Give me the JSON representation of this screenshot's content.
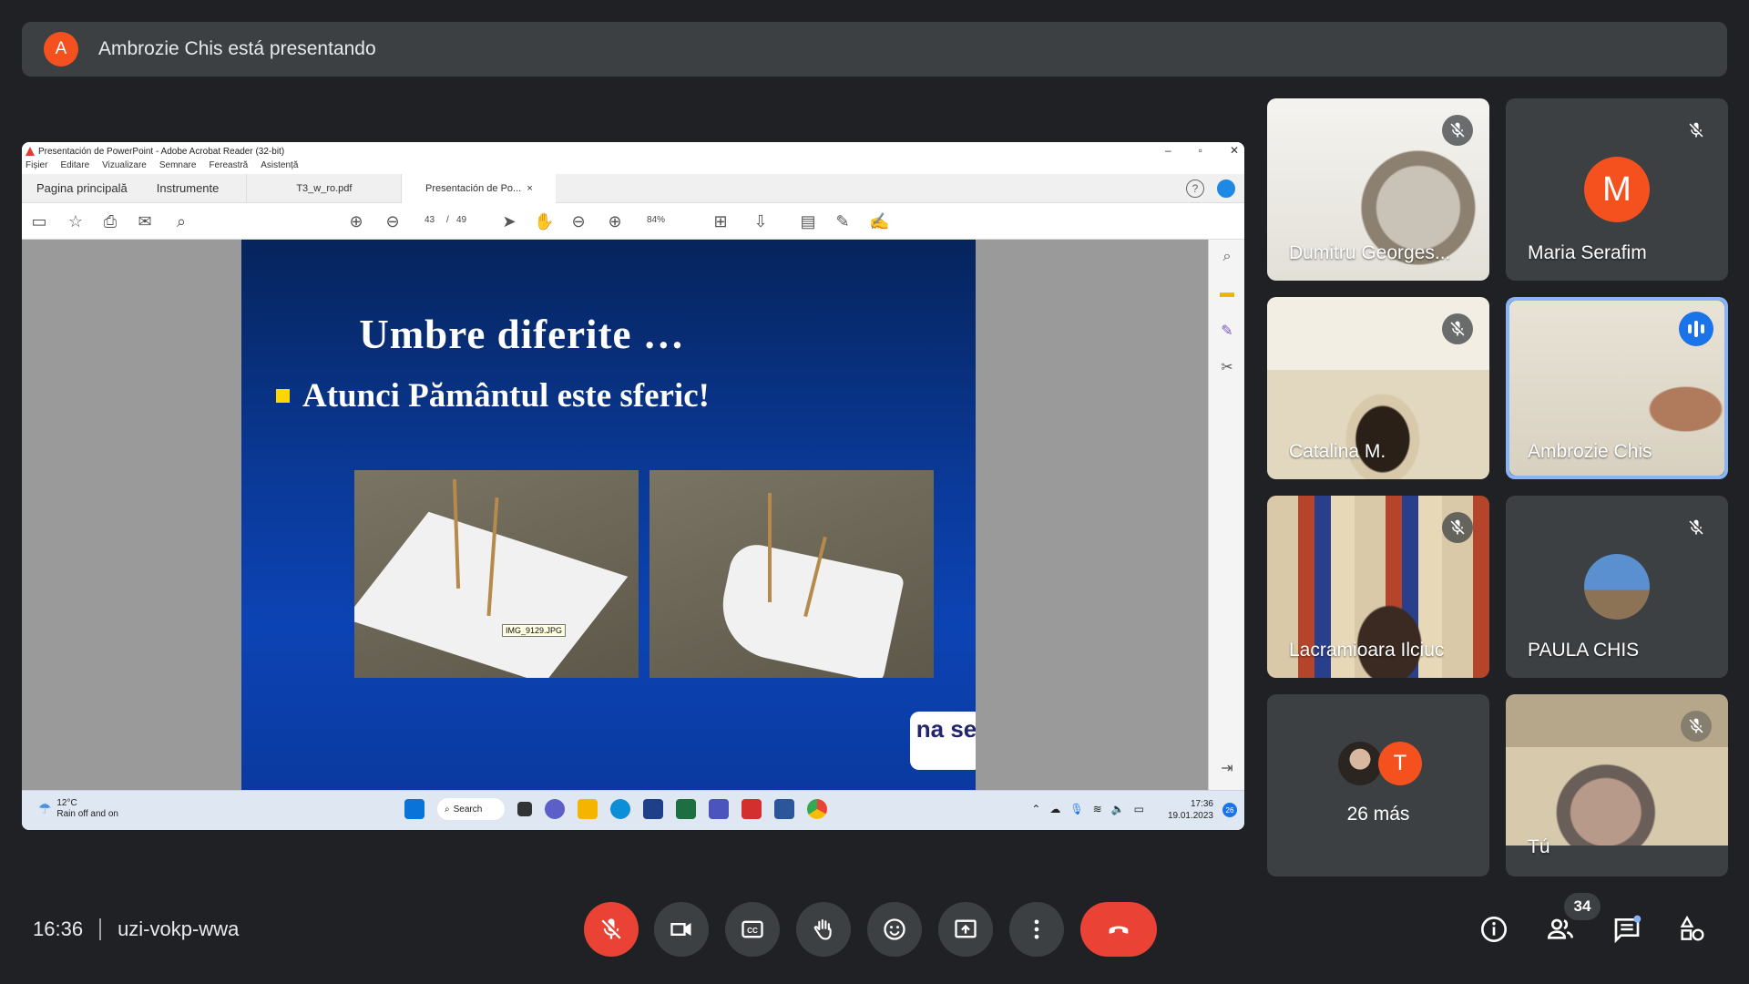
{
  "banner": {
    "avatar_letter": "A",
    "text": "Ambrozie Chis está presentando"
  },
  "shared_screen": {
    "window_title": "Presentación de PowerPoint - Adobe Acrobat Reader (32-bit)",
    "menu": [
      "Fișier",
      "Editare",
      "Vizualizare",
      "Semnare",
      "Fereastră",
      "Asistență"
    ],
    "tabs": {
      "home": "Pagina principală",
      "tools": "Instrumente",
      "doc1": "T3_w_ro.pdf",
      "doc2": "Presentación de Po..."
    },
    "page_current": "43",
    "page_sep": "/",
    "page_total": "49",
    "zoom": "84%",
    "slide": {
      "title": "Umbre diferite …",
      "bullet": "Atunci Pământul este sferic!",
      "tooltip": "IMG_9129.JPG",
      "logo": "na se"
    },
    "taskbar": {
      "temp": "12°C",
      "weather": "Rain off and on",
      "search": "Search",
      "time": "17:36",
      "date": "19.01.2023",
      "badge": "26"
    }
  },
  "participants": [
    {
      "name": "Dumitru Georges...",
      "muted": true
    },
    {
      "name": "Maria Serafim",
      "avatar_letter": "M",
      "avatar_color": "#f4511e",
      "muted": true
    },
    {
      "name": "Catalina M.",
      "muted": true
    },
    {
      "name": "Ambrozie Chis",
      "speaking": true
    },
    {
      "name": "Lacramioara Ilciuc",
      "muted": true
    },
    {
      "name": "PAULA CHIS",
      "muted": true
    },
    {
      "name": "26 más",
      "avatar_letter": "T"
    },
    {
      "name": "Tú",
      "muted": true
    }
  ],
  "bottom": {
    "time": "16:36",
    "meeting_code": "uzi-vokp-wwa",
    "participants_count": "34"
  },
  "colors": {
    "background": "#202124",
    "tile": "#3c4043",
    "danger": "#ea4335",
    "active_border": "#8ab4f8"
  }
}
